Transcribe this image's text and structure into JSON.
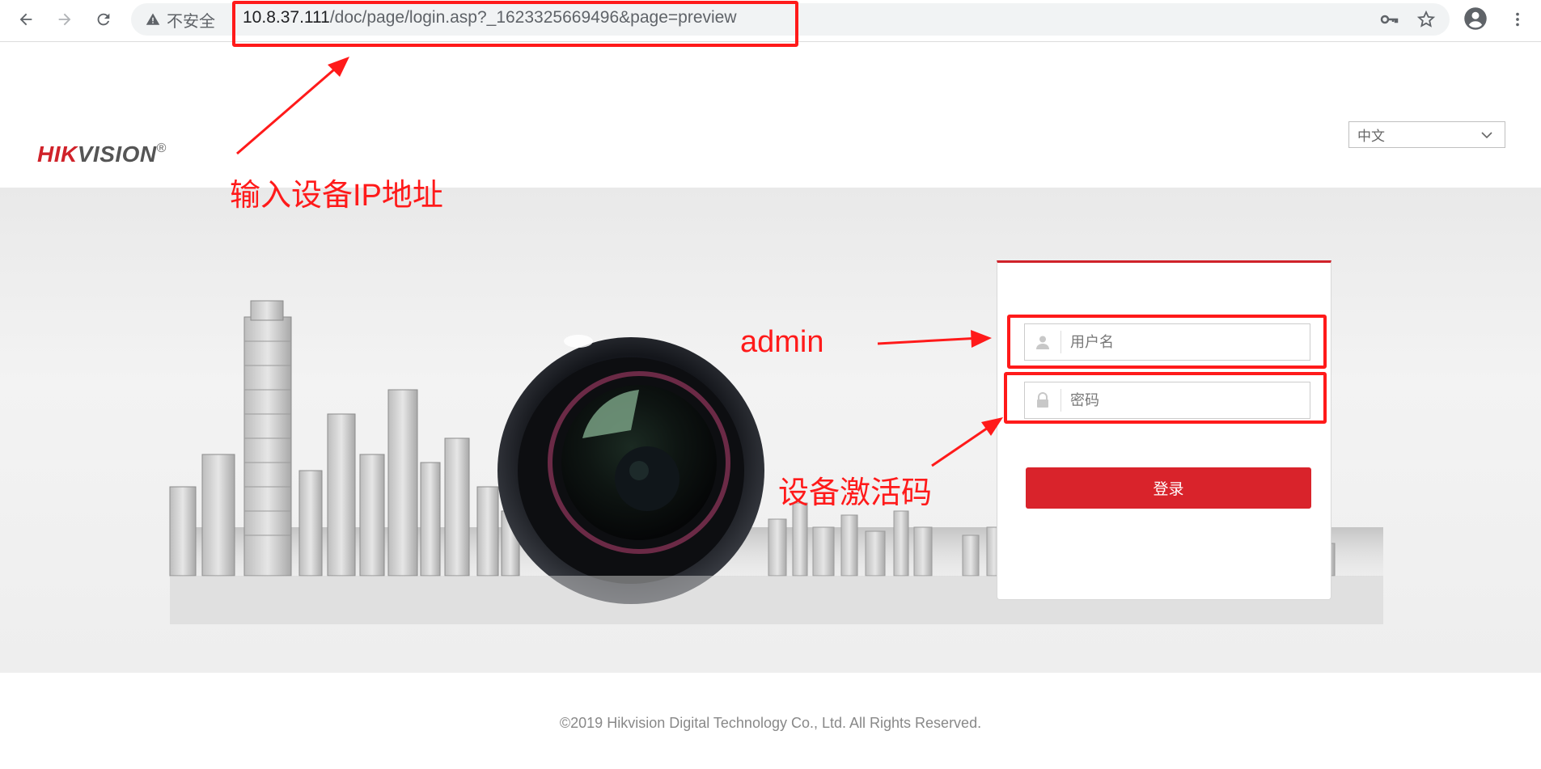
{
  "browser": {
    "security_label": "不安全",
    "url_host": "10.8.37.111",
    "url_path": "/doc/page/login.asp?_1623325669496&page=preview"
  },
  "header": {
    "logo_main": "HIK",
    "logo_rest": "VISION",
    "logo_mark": "®",
    "language_selected": "中文"
  },
  "login": {
    "username_placeholder": "用户名",
    "password_placeholder": "密码",
    "submit_label": "登录"
  },
  "annotations": {
    "ip_hint": "输入设备IP地址",
    "username_hint": "admin",
    "password_hint": "设备激活码",
    "color": "#ff1a1a"
  },
  "footer": {
    "copyright": "©2019 Hikvision Digital Technology Co., Ltd. All Rights Reserved."
  },
  "colors": {
    "brand_red": "#d0222a",
    "button_red": "#d9232b"
  }
}
